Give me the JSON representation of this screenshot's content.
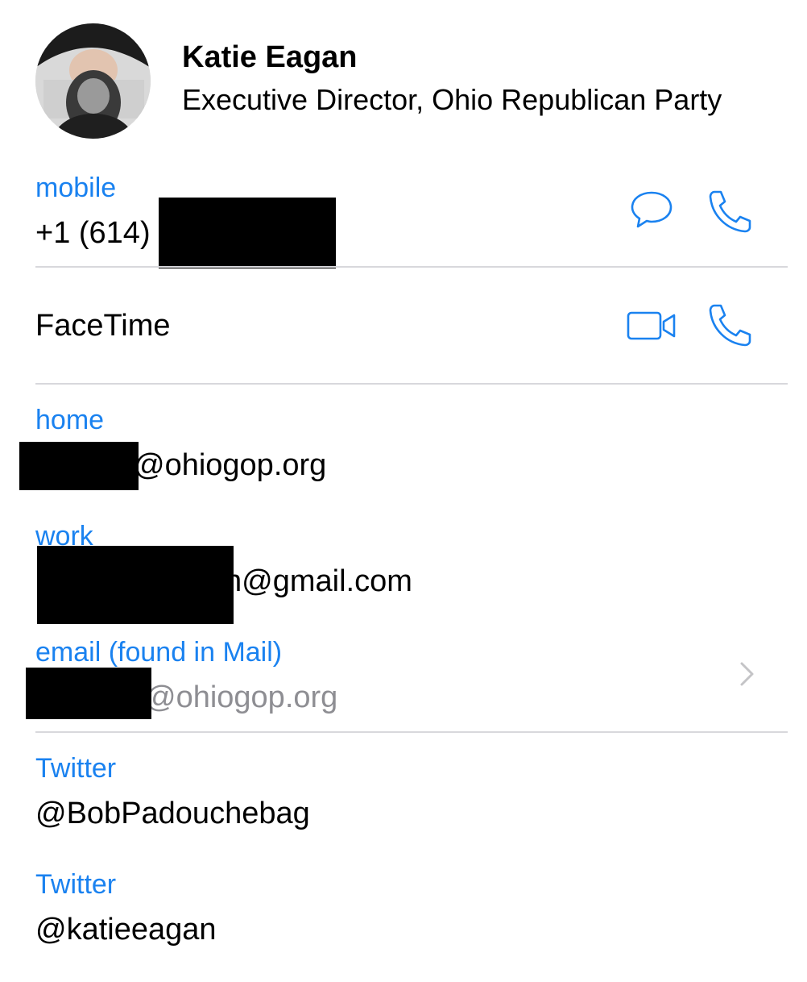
{
  "contact": {
    "name": "Katie Eagan",
    "title": "Executive Director, Ohio Republican Party"
  },
  "phone": {
    "label": "mobile",
    "value_visible": "+1 (614)",
    "icons": [
      "message-icon",
      "phone-icon"
    ]
  },
  "facetime": {
    "label": "FaceTime",
    "icons": [
      "video-icon",
      "phone-icon"
    ]
  },
  "emails": [
    {
      "label": "home",
      "value_visible": "@ohiogop.org"
    },
    {
      "label": "work",
      "value_visible": "n@gmail.com"
    },
    {
      "label": "email (found in Mail)",
      "value_visible": "@ohiogop.org",
      "chevron": "chevron-right-icon"
    }
  ],
  "twitter": [
    {
      "label": "Twitter",
      "handle": "@BobPadouchebag"
    },
    {
      "label": "Twitter",
      "handle": "@katieeagan"
    }
  ],
  "colors": {
    "accent": "#1a82f0",
    "separator": "#d8d8dc",
    "secondary_text": "#8e8e93"
  }
}
